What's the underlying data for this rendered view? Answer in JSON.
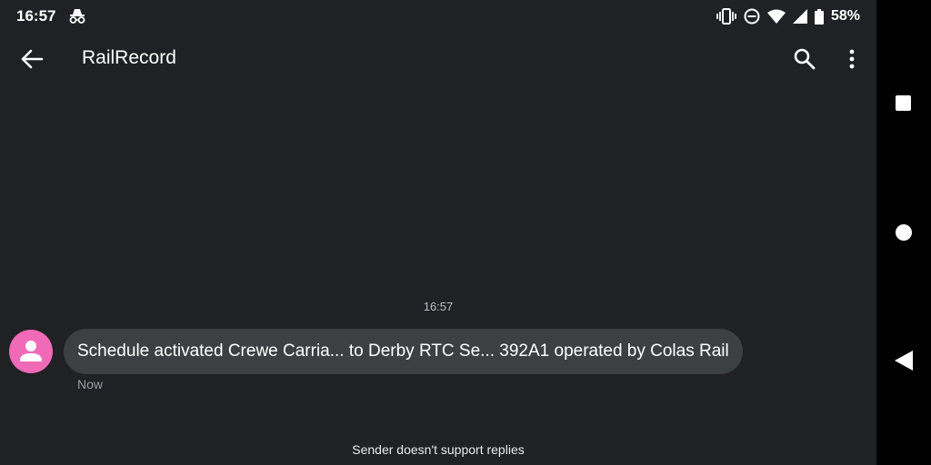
{
  "status_bar": {
    "time": "16:57",
    "battery": "58%",
    "icons": [
      "incognito-icon",
      "vibrate-icon",
      "dnd-icon",
      "wifi-icon",
      "signal-icon",
      "battery-icon"
    ]
  },
  "app_bar": {
    "title": "RailRecord",
    "icons": [
      "back-arrow-icon",
      "search-icon",
      "more-vert-icon"
    ]
  },
  "conversation": {
    "timestamp": "16:57",
    "messages": [
      {
        "text": "Schedule activated Crewe Carria... to Derby RTC Se... 392A1 operated by Colas Rail",
        "meta": "Now",
        "avatar_color": "#f06ab8"
      }
    ],
    "footer_note": "Sender doesn't support replies"
  },
  "nav_bar": {
    "buttons": [
      "recents-square-icon",
      "home-circle-icon",
      "back-triangle-icon"
    ]
  }
}
